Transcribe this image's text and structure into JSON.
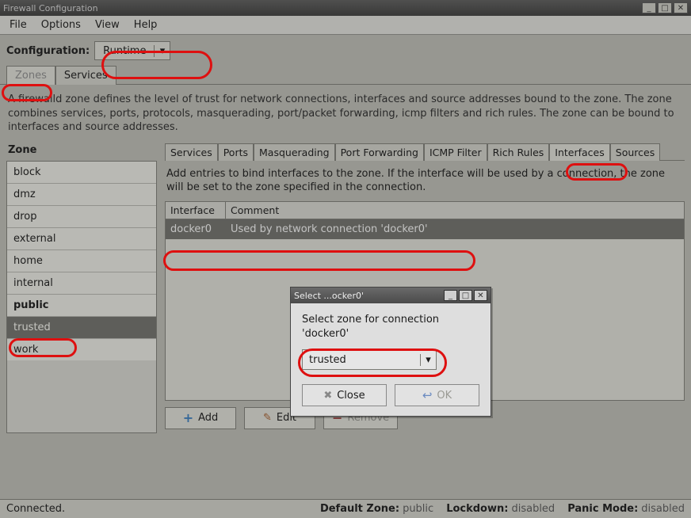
{
  "window": {
    "title": "Firewall Configuration"
  },
  "menu": {
    "file": "File",
    "options": "Options",
    "view": "View",
    "help": "Help"
  },
  "config": {
    "label": "Configuration:",
    "value": "Runtime"
  },
  "main_tabs": {
    "zones": "Zones",
    "services": "Services"
  },
  "description": "A firewalld zone defines the level of trust for network connections, interfaces and source addresses bound to the zone. The zone combines services, ports, protocols, masquerading, port/packet forwarding, icmp filters and rich rules. The zone can be bound to interfaces and source addresses.",
  "zone_header": "Zone",
  "zones": {
    "0": "block",
    "1": "dmz",
    "2": "drop",
    "3": "external",
    "4": "home",
    "5": "internal",
    "6": "public",
    "7": "trusted",
    "8": "work"
  },
  "sub_tabs": {
    "services": "Services",
    "ports": "Ports",
    "masq": "Masquerading",
    "pf": "Port Forwarding",
    "icmp": "ICMP Filter",
    "rich": "Rich Rules",
    "ifaces": "Interfaces",
    "sources": "Sources"
  },
  "iface_desc": "Add entries to bind interfaces to the zone. If the interface will be used by a connection, the zone will be set to the zone specified in the connection.",
  "iface_table": {
    "h1": "Interface",
    "h2": "Comment",
    "r1_iface": "docker0",
    "r1_comment": "Used by network connection 'docker0'"
  },
  "buttons": {
    "add": "Add",
    "edit": "Edit",
    "remove": "Remove"
  },
  "status": {
    "connected": "Connected.",
    "dz_label": "Default Zone:",
    "dz_val": "public",
    "ld_label": "Lockdown:",
    "ld_val": "disabled",
    "pm_label": "Panic Mode:",
    "pm_val": "disabled"
  },
  "dialog": {
    "title": "Select ...ocker0'",
    "msg": "Select zone for connection 'docker0'",
    "value": "trusted",
    "close": "Close",
    "ok": "OK"
  }
}
